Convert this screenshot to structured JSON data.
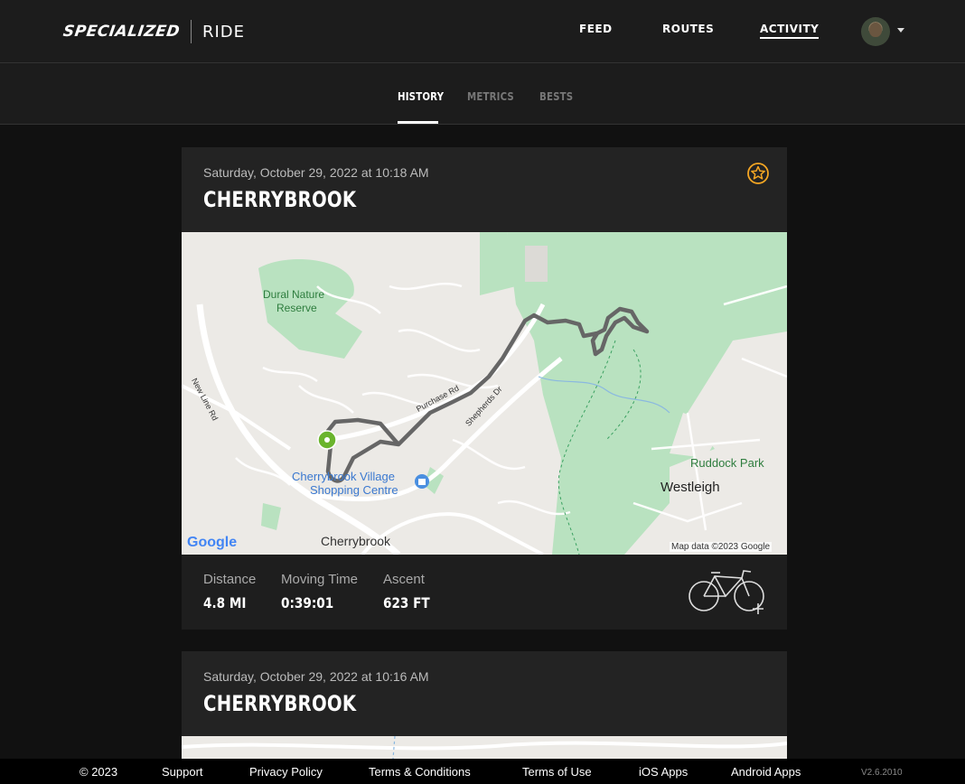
{
  "header": {
    "brand_logo": "SPECIALIZED",
    "brand_app": "RIDE",
    "nav": [
      {
        "label": "FEED",
        "active": false
      },
      {
        "label": "ROUTES",
        "active": false
      },
      {
        "label": "ACTIVITY",
        "active": true
      }
    ],
    "avatar_icon": "user-avatar",
    "menu_icon": "caret-down-icon"
  },
  "subnav": {
    "tabs": [
      {
        "label": "HISTORY",
        "active": true
      },
      {
        "label": "METRICS",
        "active": false
      },
      {
        "label": "BESTS",
        "active": false
      }
    ]
  },
  "activities": [
    {
      "date": "Saturday, October 29, 2022 at 10:18 AM",
      "title": "CHERRYBROOK",
      "badge_icon": "star-badge-icon",
      "map": {
        "labels": {
          "dural_1": "Dural Nature",
          "dural_2": "Reserve",
          "new_line": "New Line Rd",
          "purchase": "Purchase Rd",
          "shepherds": "Shepherds Dr",
          "village_1": "Cherrybrook Village",
          "village_2": "Shopping Centre",
          "cherrybrook": "Cherrybrook",
          "ruddock": "Ruddock Park",
          "westleigh": "Westleigh"
        },
        "google_logo": "Google",
        "attribution": "Map data ©2023 Google"
      },
      "stats": [
        {
          "label": "Distance",
          "value": "4.8 MI"
        },
        {
          "label": "Moving Time",
          "value": "0:39:01"
        },
        {
          "label": "Ascent",
          "value": "623 FT"
        }
      ],
      "bike_icon": "add-bike-icon"
    },
    {
      "date": "Saturday, October 29, 2022 at 10:16 AM",
      "title": "CHERRYBROOK"
    }
  ],
  "footer": {
    "copyright": "© 2023",
    "links": [
      "Support",
      "Privacy Policy",
      "Terms & Conditions",
      "Terms of Use",
      "iOS Apps",
      "Android Apps"
    ],
    "version": "V2.6.2010"
  },
  "colors": {
    "accent_orange": "#f5a623",
    "start_marker": "#6ab42d",
    "park_green": "#b5e0bc",
    "route": "#555555"
  }
}
